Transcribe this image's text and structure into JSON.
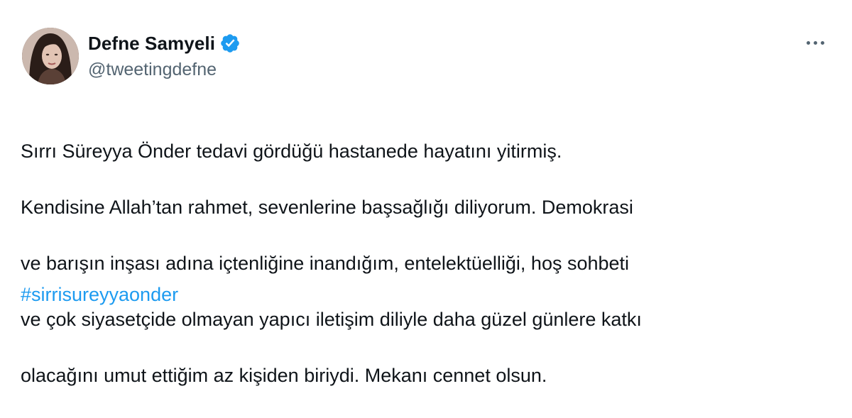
{
  "author": {
    "display_name": "Defne Samyeli",
    "handle": "@tweetingdefne",
    "verified": true,
    "avatar_icon": "profile-photo",
    "verified_icon": "verified-badge-icon"
  },
  "tweet": {
    "lines": [
      "Sırrı Süreyya Önder tedavi gördüğü hastanede hayatını yitirmiş.",
      "Kendisine Allah’tan rahmet, sevenlerine başsağlığı diliyorum. Demokrasi",
      "ve barışın inşası adına içtenliğine inandığım, entelektüelliği, hoş sohbeti",
      "ve çok siyasetçide olmayan yapıcı iletişim diliyle daha güzel günlere katkı",
      "olacağını umut ettiğim az kişiden biriydi. Mekanı cennet olsun."
    ],
    "hashtag": "#sirrisureyyaonder"
  },
  "menu": {
    "icon": "more-options-icon"
  },
  "colors": {
    "text": "#0f1419",
    "secondary": "#536471",
    "accent": "#1d9bf0"
  }
}
